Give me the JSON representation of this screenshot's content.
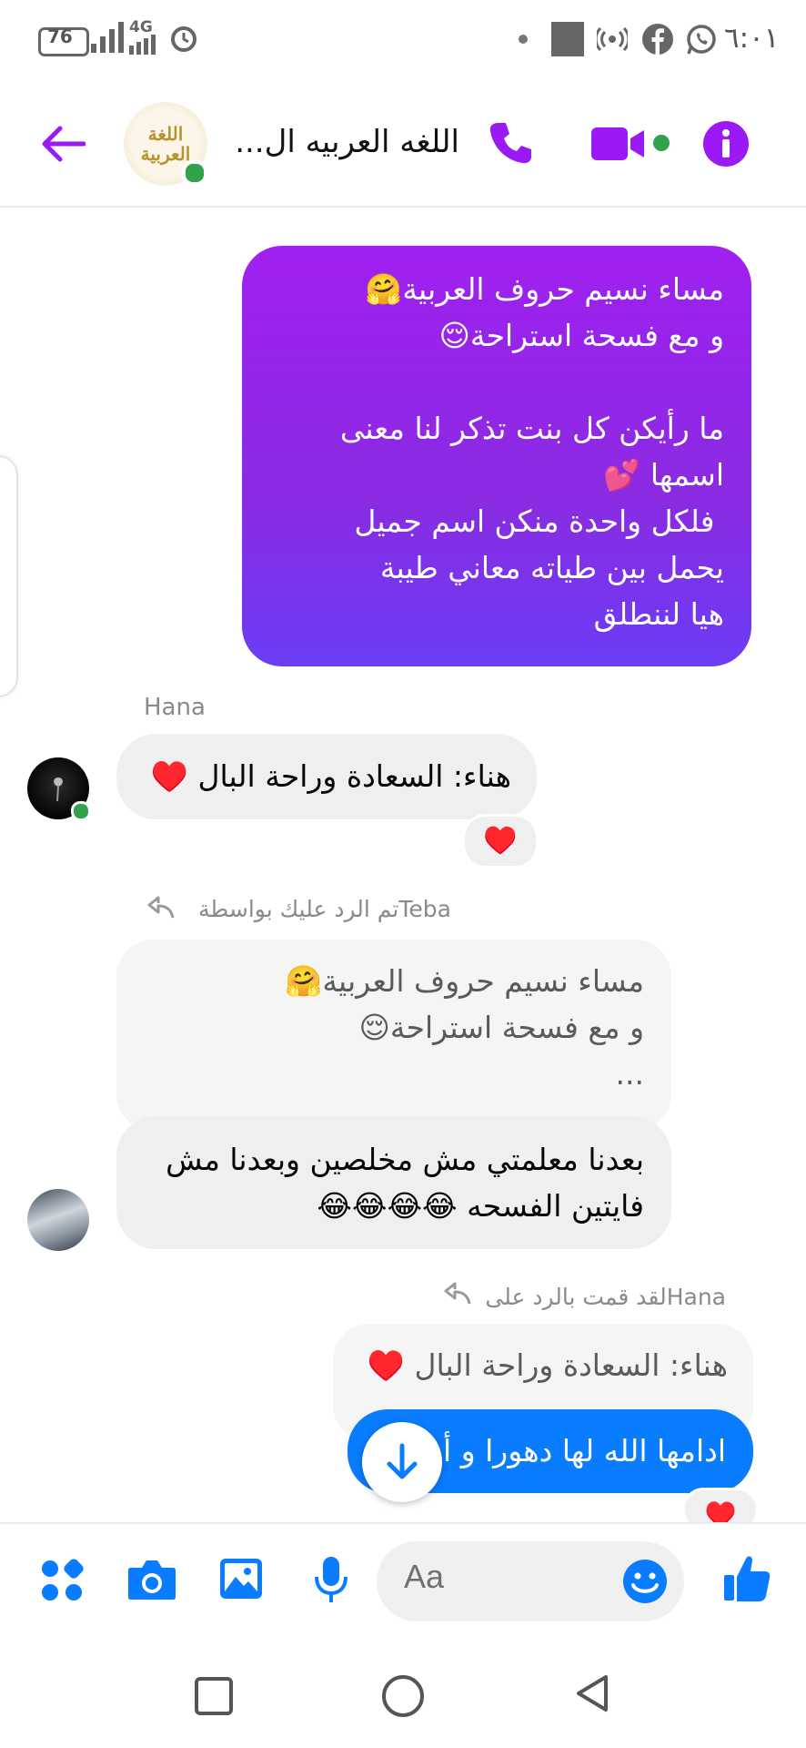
{
  "status_bar": {
    "time": "٦:٠١",
    "battery": "76",
    "network": "4G"
  },
  "header": {
    "title": "اللغه العربيه ال...",
    "avatar_text": "اللغة العربية"
  },
  "messages": {
    "m1_lines": [
      "مساء نسيم حروف العربية🤗",
      "و مع فسحة استراحة😌",
      "",
      "ما رأيكن كل بنت تذكر لنا معنى",
      "اسمها 💕",
      " فلكل واحدة منكن اسم جميل",
      "يحمل بين طياته معاني طيبة",
      "هيا لننطلق"
    ],
    "hana_name": "Hana",
    "hana_msg": "هناء: السعادة وراحة البال ♥️",
    "hana_reaction": "♥️",
    "teba_reply_label": "Tebaتم الرد عليك بواسطة",
    "teba_quote_lines": [
      "مساء نسيم حروف العربية🤗",
      "و مع فسحة استراحة😌",
      "..."
    ],
    "teba_msg_lines": [
      "بعدنا معلمتي مش مخلصين وبعدنا مش",
      "فايتين الفسحه 😂😂😂😂"
    ],
    "my_reply_label": "Hanaلقد قمت بالرد على",
    "my_quote": "هناء: السعادة وراحة البال ♥️",
    "my_msg": "ادامها الله لها دهورا و أ",
    "my_reaction": "♥️"
  },
  "composer": {
    "placeholder": "Aa"
  },
  "colors": {
    "accent_purple": "#9b19f5",
    "messenger_blue": "#0a7cff",
    "online_green": "#31a24c"
  }
}
